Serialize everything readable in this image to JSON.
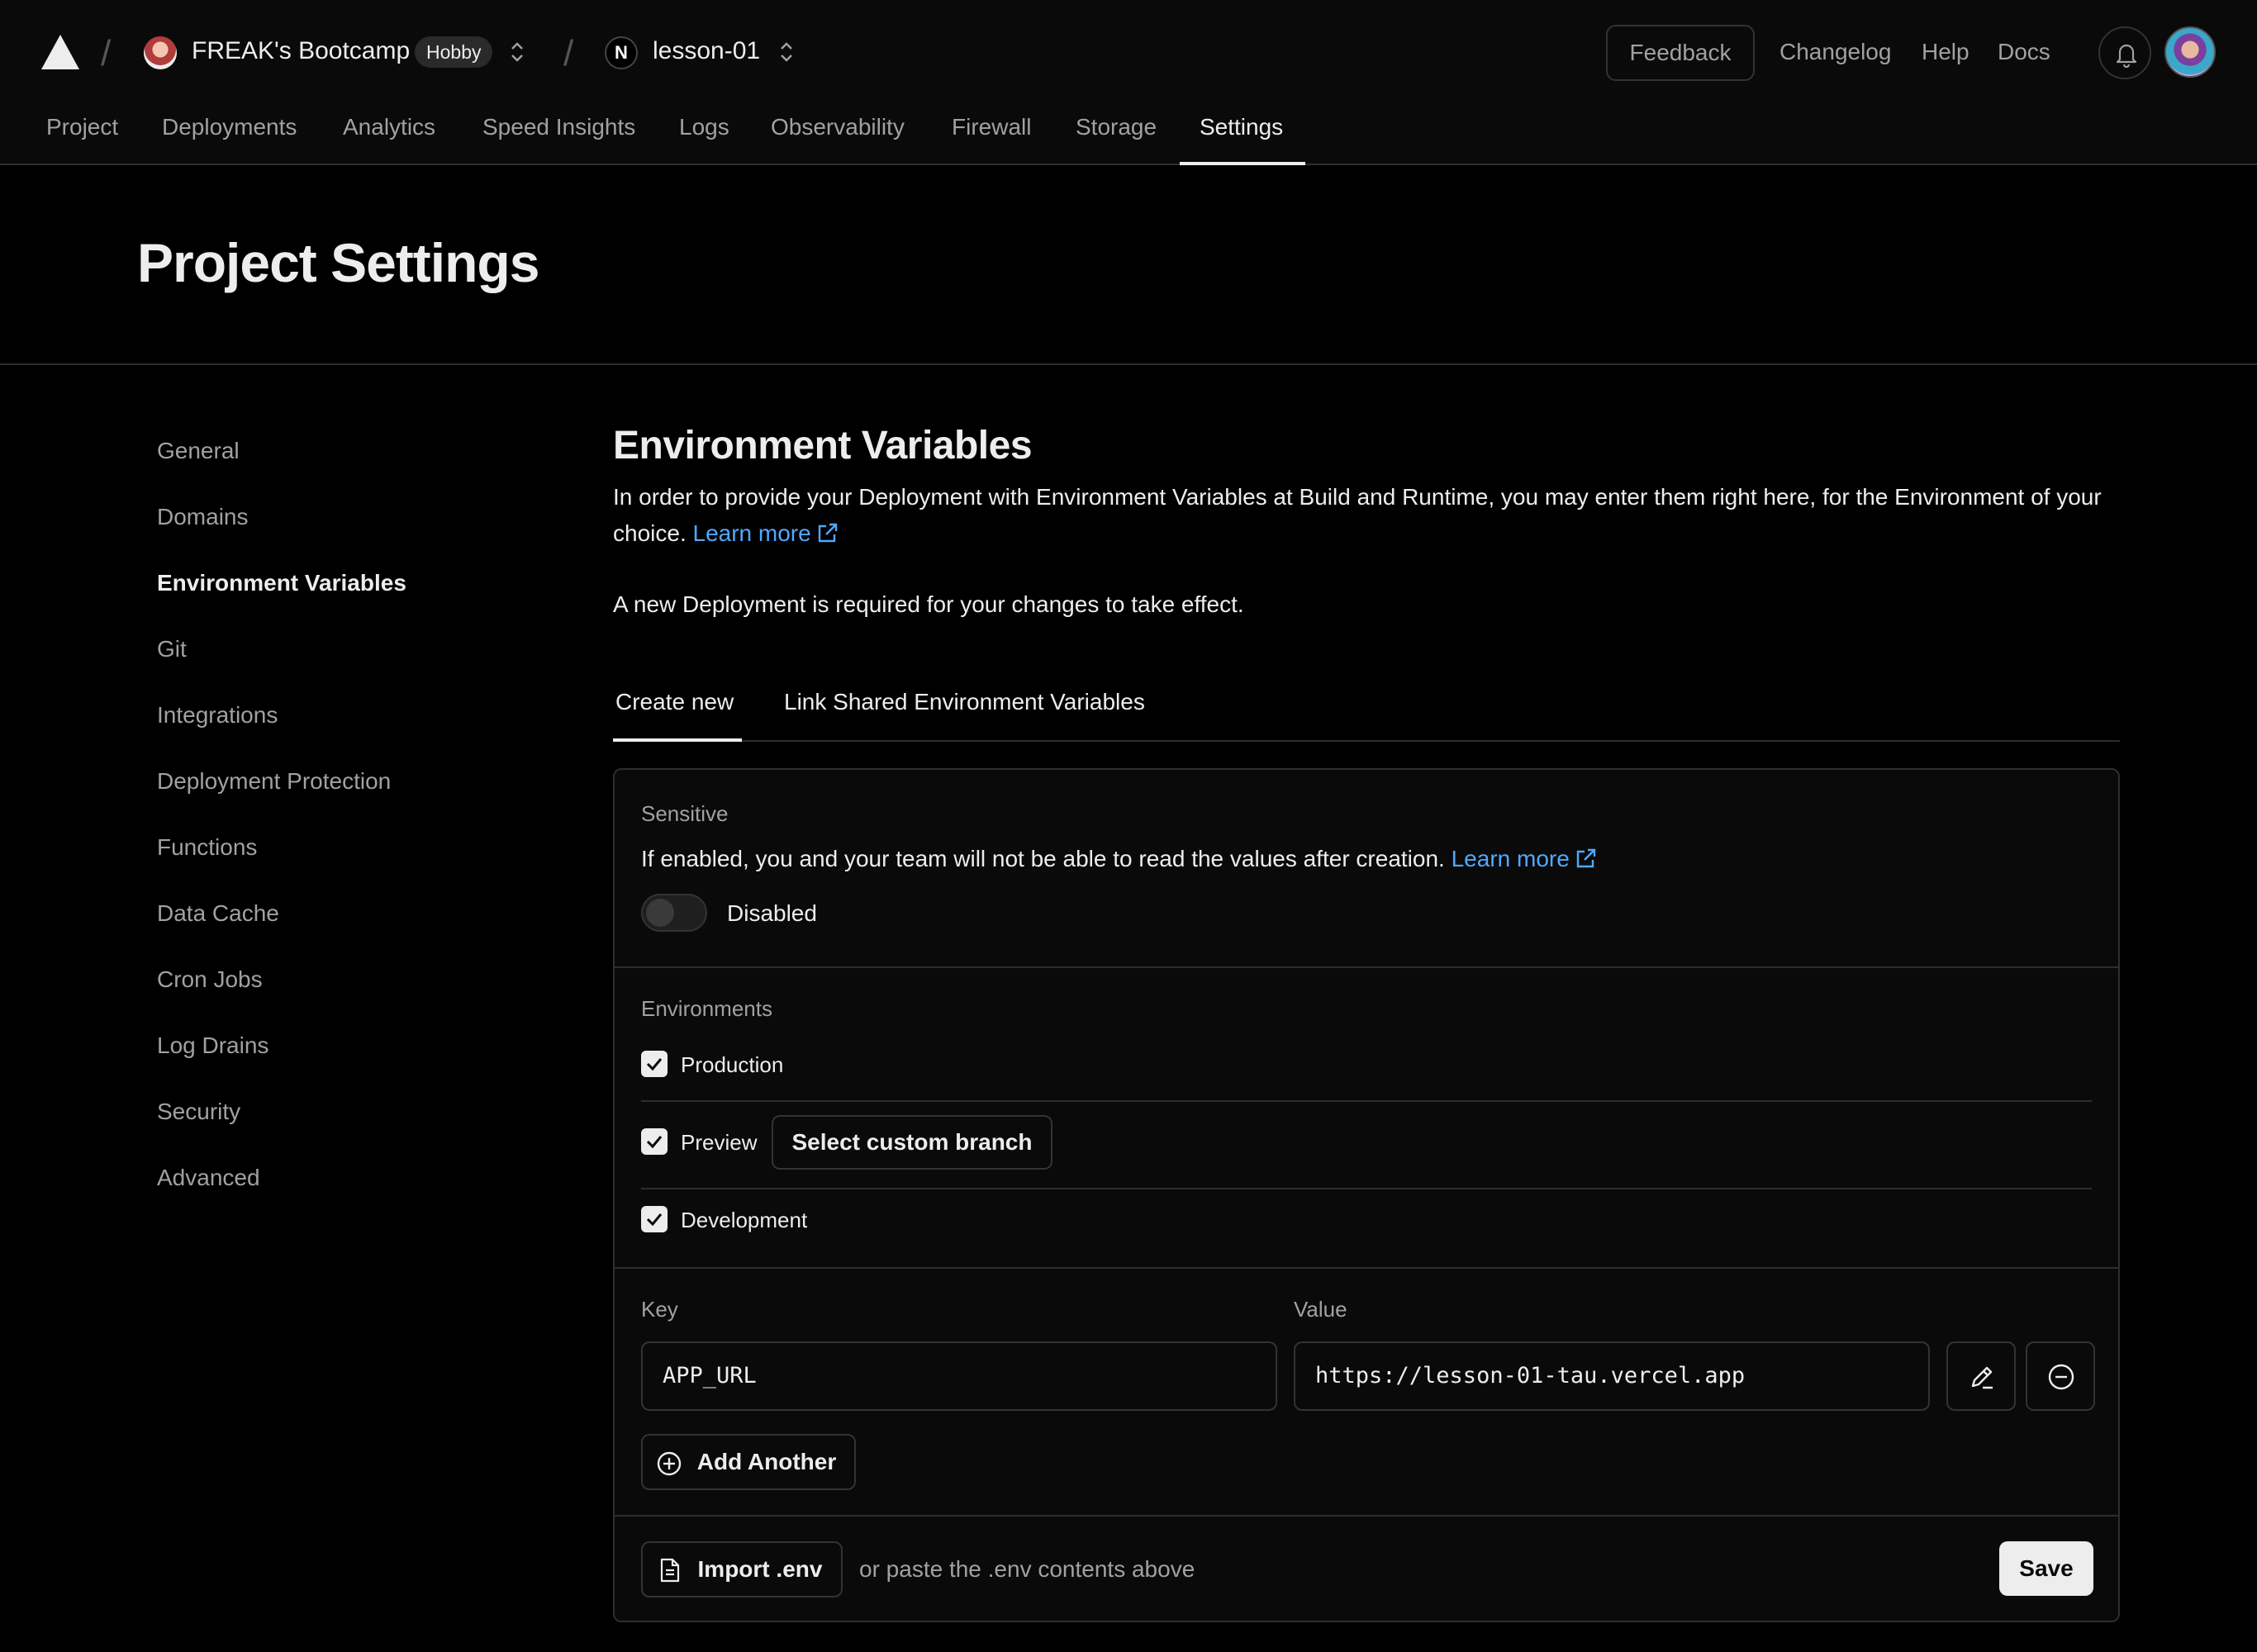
{
  "header": {
    "team_name": "FREAK's Bootcamp",
    "plan_badge": "Hobby",
    "project_initial": "N",
    "project_name": "lesson-01",
    "feedback_label": "Feedback",
    "links": [
      "Changelog",
      "Help",
      "Docs"
    ]
  },
  "nav": {
    "items": [
      "Project",
      "Deployments",
      "Analytics",
      "Speed Insights",
      "Logs",
      "Observability",
      "Firewall",
      "Storage",
      "Settings"
    ],
    "active": "Settings"
  },
  "page": {
    "title": "Project Settings"
  },
  "sidebar": {
    "items": [
      "General",
      "Domains",
      "Environment Variables",
      "Git",
      "Integrations",
      "Deployment Protection",
      "Functions",
      "Data Cache",
      "Cron Jobs",
      "Log Drains",
      "Security",
      "Advanced"
    ],
    "active": "Environment Variables"
  },
  "content": {
    "title": "Environment Variables",
    "description": "In order to provide your Deployment with Environment Variables at Build and Runtime, you may enter them right here, for the Environment of your choice.",
    "learn_more": "Learn more",
    "note": "A new Deployment is required for your changes to take effect.",
    "tabs": [
      "Create new",
      "Link Shared Environment Variables"
    ],
    "active_tab": "Create new"
  },
  "form": {
    "sensitive_label": "Sensitive",
    "sensitive_desc": "If enabled, you and your team will not be able to read the values after creation.",
    "learn_more": "Learn more",
    "sensitive_state": "Disabled",
    "environments_label": "Environments",
    "environments": [
      {
        "name": "Production",
        "checked": true
      },
      {
        "name": "Preview",
        "checked": true
      },
      {
        "name": "Development",
        "checked": true
      }
    ],
    "custom_branch_label": "Select custom branch",
    "key_label": "Key",
    "value_label": "Value",
    "key_value": "APP_URL",
    "value_value": "https://lesson-01-tau.vercel.app",
    "add_another_label": "Add Another",
    "import_label": "Import .env",
    "paste_hint": "or paste the .env contents above",
    "save_label": "Save"
  },
  "colors": {
    "accent_link": "#52a8ff",
    "background": "#000000",
    "surface": "#0a0a0a",
    "border": "#2e2e2e"
  }
}
